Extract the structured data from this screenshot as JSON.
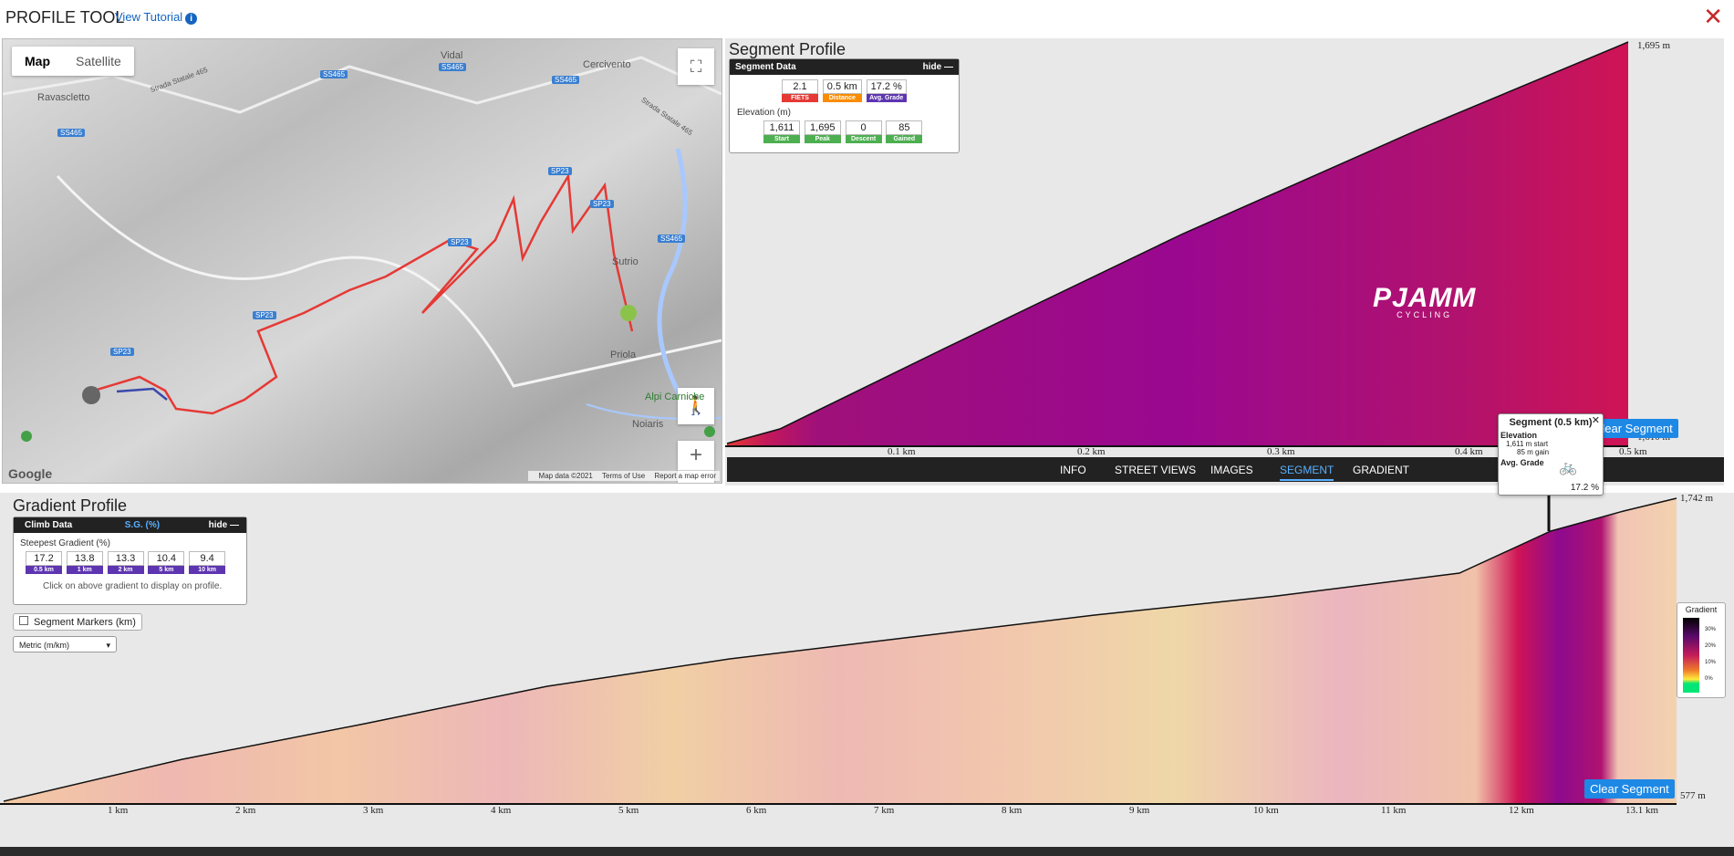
{
  "header": {
    "title": "PROFILE TOOL",
    "tutorial": "View Tutorial",
    "info_icon": "i",
    "close": "✕"
  },
  "map": {
    "toggle": [
      "Map",
      "Satellite"
    ],
    "zoom_in": "+",
    "zoom_out": "−",
    "footer": [
      "Map data ©2021",
      "Terms of Use",
      "Report a map error"
    ],
    "logo": "Google",
    "places": [
      "Vidal",
      "Cercivento",
      "Ravascletto",
      "Sutrio",
      "Priola",
      "Noiaris",
      "Alpi Carniche",
      "Strada Statale 465",
      "Strada Statale 465"
    ],
    "roads": [
      "SS465",
      "SS465",
      "SS465",
      "SS465",
      "SS465",
      "SP23",
      "SP23",
      "SP23",
      "SP23",
      "SP23"
    ]
  },
  "segment": {
    "title": "Segment Profile",
    "box_title": "Segment Data",
    "hide": "hide",
    "stats": [
      {
        "v": "2.1",
        "t": "FIETS",
        "c": "#e53935"
      },
      {
        "v": "0.5 km",
        "t": "Distance",
        "c": "#fb8c00"
      },
      {
        "v": "17.2 %",
        "t": "Avg. Grade",
        "c": "#5e35b1"
      }
    ],
    "elev_label": "Elevation (m)",
    "elev": [
      {
        "v": "1,611",
        "t": "Start"
      },
      {
        "v": "1,695",
        "t": "Peak"
      },
      {
        "v": "0",
        "t": "Descent"
      },
      {
        "v": "85",
        "t": "Gained"
      }
    ],
    "y_top": "1,695 m",
    "y_bottom": "1,610 m",
    "ticks": [
      "0.1 km",
      "0.2 km",
      "0.3 km",
      "0.4 km",
      "0.5 km"
    ],
    "clear": "Clear Segment",
    "logo_main": "PJAMM",
    "logo_sub": "CYCLING"
  },
  "tabs": [
    "INFO",
    "STREET VIEWS",
    "IMAGES",
    "SEGMENT",
    "GRADIENT"
  ],
  "active_tab": "SEGMENT",
  "popup": {
    "title": "Segment (0.5 km)",
    "elev": "Elevation",
    "start": "1,611 m start",
    "gain": "85 m gain",
    "avg": "Avg. Grade",
    "grade": "17.2 %"
  },
  "gradient": {
    "title": "Gradient Profile",
    "tab1": "Climb Data",
    "tab2": "S.G. (%)",
    "hide": "hide",
    "sg_label": "Steepest Gradient (%)",
    "sg": [
      {
        "v": "17.2",
        "t": "0.5 km"
      },
      {
        "v": "13.8",
        "t": "1 km"
      },
      {
        "v": "13.3",
        "t": "2 km"
      },
      {
        "v": "10.4",
        "t": "5 km"
      },
      {
        "v": "9.4",
        "t": "10 km"
      }
    ],
    "hint": "Click on above gradient to display on profile.",
    "markers": "Segment Markers (km)",
    "units": "Metric (m/km)",
    "y_top": "1,742 m",
    "y_bottom": "577 m",
    "ticks": [
      "1 km",
      "2 km",
      "3 km",
      "4 km",
      "5 km",
      "6 km",
      "7 km",
      "8 km",
      "9 km",
      "10 km",
      "11 km",
      "12 km",
      "13.1 km"
    ],
    "clear": "Clear Segment",
    "legend_title": "Gradient",
    "legend_ticks": [
      "30%",
      "20%",
      "10%",
      "0%"
    ]
  }
}
